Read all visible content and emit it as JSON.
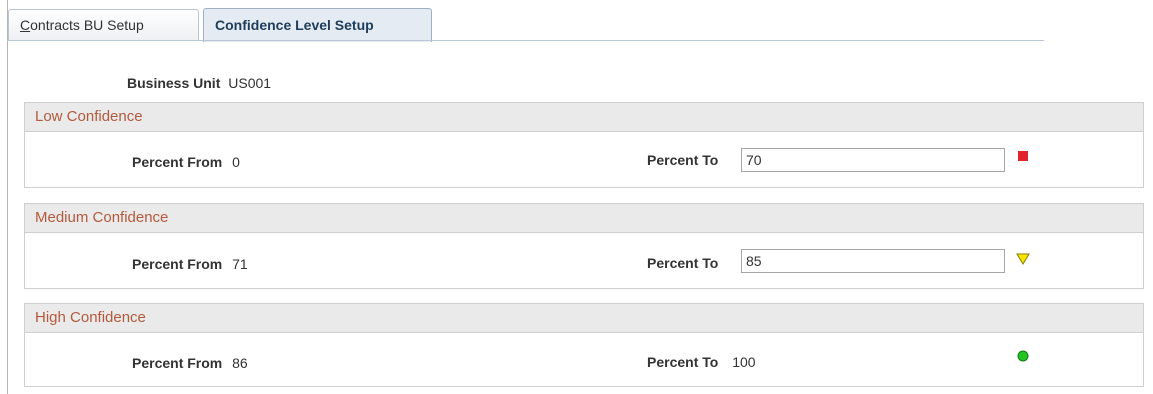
{
  "tabs": {
    "contracts_bu_setup": {
      "accesskey": "C",
      "rest": "ontracts BU Setup"
    },
    "confidence_level_setup": "Confidence Level Setup"
  },
  "business_unit": {
    "label": "Business Unit",
    "value": "US001"
  },
  "groups": {
    "low": {
      "title": "Low Confidence",
      "percent_from_label": "Percent From",
      "percent_from": "0",
      "percent_to_label": "Percent To",
      "percent_to": "70",
      "indicator_icon": "red-square-icon",
      "indicator_color": "#e0262c"
    },
    "medium": {
      "title": "Medium Confidence",
      "percent_from_label": "Percent From",
      "percent_from": "71",
      "percent_to_label": "Percent To",
      "percent_to": "85",
      "indicator_icon": "yellow-triangle-down-icon",
      "indicator_color": "#f5e600"
    },
    "high": {
      "title": "High Confidence",
      "percent_from_label": "Percent From",
      "percent_from": "86",
      "percent_to_label": "Percent To",
      "percent_to": "100",
      "indicator_icon": "green-circle-icon",
      "indicator_color": "#22c422"
    }
  }
}
